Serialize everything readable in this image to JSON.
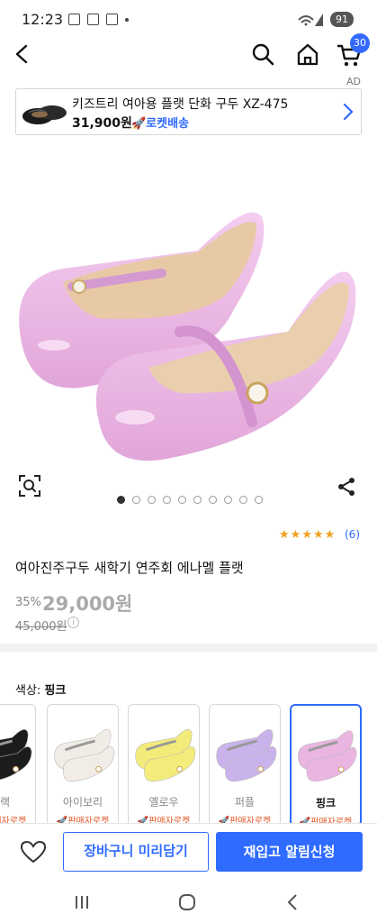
{
  "status_bar": {
    "time": "12:23",
    "battery": "91"
  },
  "header": {
    "cart_count": "30",
    "ad_label": "AD"
  },
  "ad_banner": {
    "title": "키즈트리 여아용 플랫 단화 구두 XZ-475",
    "price": "31,900원",
    "delivery": "🚀로켓배송"
  },
  "gallery": {
    "total_images": 10,
    "current_index": 1
  },
  "product": {
    "rating": 5,
    "review_count": "(6)",
    "title": "여아진주구두 새학기 연주회 에나멜 플랫",
    "discount": "35%",
    "price": "29,000원",
    "original_price": "45,000원"
  },
  "options": {
    "label_prefix": "색상: ",
    "selected": "핑크",
    "items": [
      {
        "name": "블랙",
        "tag": "🚀판매자로켓",
        "color": "#1c1c1c"
      },
      {
        "name": "아이보리",
        "tag": "🚀판매자로켓",
        "color": "#f1ede6"
      },
      {
        "name": "옐로우",
        "tag": "🚀판매자로켓",
        "color": "#f3ec7a"
      },
      {
        "name": "퍼플",
        "tag": "🚀판매자로켓",
        "color": "#c9b3ea"
      },
      {
        "name": "핑크",
        "tag": "🚀판매자로켓",
        "color": "#eab5e0"
      }
    ]
  },
  "actions": {
    "cart_label": "장바구니 미리담기",
    "notify_label": "재입고 알림신청"
  },
  "colors": {
    "accent": "#2f6bff",
    "rating": "#f0a020",
    "shoe_pink": "#eab5e0"
  }
}
